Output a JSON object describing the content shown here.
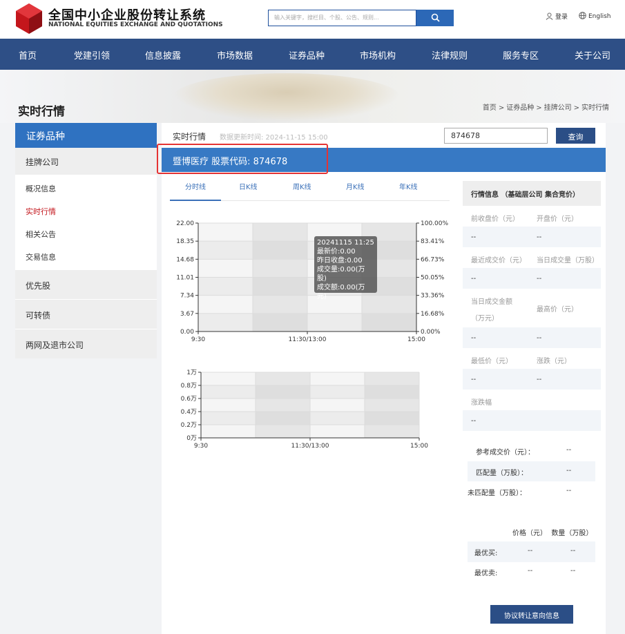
{
  "header": {
    "logo_cn": "全国中小企业股份转让系统",
    "logo_en": "NATIONAL EQUITIES EXCHANGE AND QUOTATIONS",
    "search_placeholder": "输入关键字，搜栏目、个股、公告、规则...",
    "login": "登录",
    "language": "English"
  },
  "nav": [
    "首页",
    "党建引领",
    "信息披露",
    "市场数据",
    "证券品种",
    "市场机构",
    "法律规则",
    "服务专区",
    "关于公司"
  ],
  "page": {
    "title": "实时行情",
    "breadcrumb": [
      "首页",
      "证券品种",
      "挂牌公司",
      "实时行情"
    ]
  },
  "sidebar": {
    "title": "证券品种",
    "selected": "挂牌公司",
    "sub_items": [
      "概况信息",
      "实时行情",
      "相关公告",
      "交易信息"
    ],
    "others": [
      "优先股",
      "可转债",
      "两网及退市公司"
    ]
  },
  "main": {
    "realtime_label": "实时行情",
    "update_time": "数据更新时间: 2024-11-15 15:00",
    "code_value": "874678",
    "query_button": "查询",
    "stock_name": "暨博医疗 股票代码:  874678",
    "tabs": [
      "分时线",
      "日K线",
      "周K线",
      "月K线",
      "年K线"
    ]
  },
  "chart_data": [
    {
      "type": "line",
      "y_left_ticks": [
        "22.00",
        "18.35",
        "14.68",
        "11.01",
        "7.34",
        "3.67",
        "0.00"
      ],
      "y_right_ticks": [
        "100.00%",
        "83.41%",
        "66.73%",
        "50.05%",
        "33.36%",
        "16.68%",
        "0.00%"
      ],
      "x_ticks": [
        "9:30",
        "11:30/13:00",
        "15:00"
      ],
      "ylim": [
        0,
        22
      ],
      "series": [],
      "tooltip": [
        "20241115 11:25",
        "最新价:0.00",
        "昨日收盘:0.00",
        "成交量:0.00(万股)",
        "成交额:0.00(万元)"
      ]
    },
    {
      "type": "bar",
      "y_ticks": [
        "1万",
        "0.8万",
        "0.6万",
        "0.4万",
        "0.2万",
        "0万"
      ],
      "x_ticks": [
        "9:30",
        "11:30/13:00",
        "15:00"
      ],
      "ylim": [
        0,
        10000
      ],
      "series": []
    }
  ],
  "info": {
    "title": "行情信息  （基础层公司 集合竞价）",
    "rows": [
      {
        "l1": "前收盘价（元）",
        "l2": "开盘价（元）",
        "v1": "--",
        "v2": "--"
      },
      {
        "l1": "最近成交价（元）",
        "l2": "当日成交量（万股）",
        "v1": "--",
        "v2": "--"
      },
      {
        "l1": "当日成交金额（万元）",
        "l2": "最高价（元）",
        "v1": "--",
        "v2": "--"
      },
      {
        "l1": "最低价（元）",
        "l2": "涨跌（元）",
        "v1": "--",
        "v2": "--"
      },
      {
        "l1": "涨跌幅",
        "l2": "",
        "v1": "--",
        "v2": ""
      }
    ],
    "ref": [
      {
        "label": "参考成交价（元）：",
        "value": "--"
      },
      {
        "label": "匹配量（万股）：",
        "value": "--"
      },
      {
        "label": "未匹配量（万股）：",
        "value": "--"
      }
    ],
    "best_headers": [
      "价格（元）",
      "数量（万股）"
    ],
    "best": [
      {
        "label": "最优买:",
        "price": "--",
        "qty": "--"
      },
      {
        "label": "最优卖:",
        "price": "--",
        "qty": "--"
      }
    ],
    "protocol_button": "协议转让意向信息"
  },
  "colors": {
    "nav": "#2e4f86",
    "accent": "#2f72c1",
    "highlight_box": "#e53333"
  }
}
